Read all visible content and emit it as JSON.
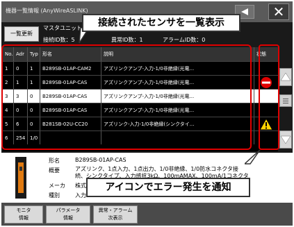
{
  "window": {
    "title": "機器一覧情報 (AnyWireASLINK)",
    "refresh_label": "一覧更新",
    "master_unit_label": "マスタユニット",
    "connected_count_text": "接続ID数：5",
    "error_count_text": "異常ID数：1",
    "alarm_count_text": "アラームID数：0",
    "close_symbol": "✕"
  },
  "table": {
    "headers": {
      "no": "No.",
      "adr": "Adr",
      "typ": "Typ",
      "name": "形名",
      "desc": "説明",
      "status": "状態"
    },
    "rows": [
      {
        "no": "1",
        "adr": "0",
        "typ": "1",
        "name": "B289SB-01AP-CAM2",
        "desc": "アズリンクアンプ-入力-1/0非絶縁(光電...",
        "status": ""
      },
      {
        "no": "2",
        "adr": "1",
        "typ": "1",
        "name": "B289SB-01AP-CAS",
        "desc": "アズリンクアンプ-入力-1/0非絶縁(光電...",
        "status": "error"
      },
      {
        "no": "3",
        "adr": "3",
        "typ": "0",
        "name": "B289SB-01AP-CAS",
        "desc": "アズリンクアンプ-入力-1/0非絶縁(光電...",
        "status": ""
      },
      {
        "no": "4",
        "adr": "0",
        "typ": "0",
        "name": "B289SB-01AP-CAS",
        "desc": "アズリンクアンプ-入力-1/0非絶縁(光電...",
        "status": ""
      },
      {
        "no": "5",
        "adr": "6",
        "typ": "0",
        "name": "B281SB-02U-CC20",
        "desc": "アズリンク-入力-1/0非絶縁(シンクタイ...",
        "status": "warning"
      },
      {
        "no": "6",
        "adr": "254",
        "typ": "1/0",
        "name": "",
        "desc": "",
        "status": ""
      }
    ],
    "selected_row": 2
  },
  "detail": {
    "model_label": "形名",
    "model_value": "B289SB-01AP-CAS",
    "summary_label": "概要",
    "summary_line1": "アズリンク、1点入力、1点出力、1/0非絶縁、1/0防水コネクタ接",
    "summary_line2": "続、シンクタイプ、入力感抗3kΩ、100mAMAX、100mA/1コネクタ",
    "maker_label": "メーカ",
    "maker_value": "株式...",
    "kind_label": "種別",
    "kind_value": "入力..."
  },
  "bottom_buttons": [
    {
      "line1": "モニタ",
      "line2": "情報"
    },
    {
      "line1": "パラメータ",
      "line2": "情報"
    },
    {
      "line1": "異常・アラーム",
      "line2": "次表示"
    }
  ],
  "annotations": {
    "top": "接続されたセンサを一覧表示",
    "bottom": "アイコンでエラー発生を通知"
  },
  "colors": {
    "annotation_frame": "#e00000",
    "error_icon": "#e00000",
    "warning_icon": "#ffd400",
    "selected_row": "#ffffff"
  }
}
